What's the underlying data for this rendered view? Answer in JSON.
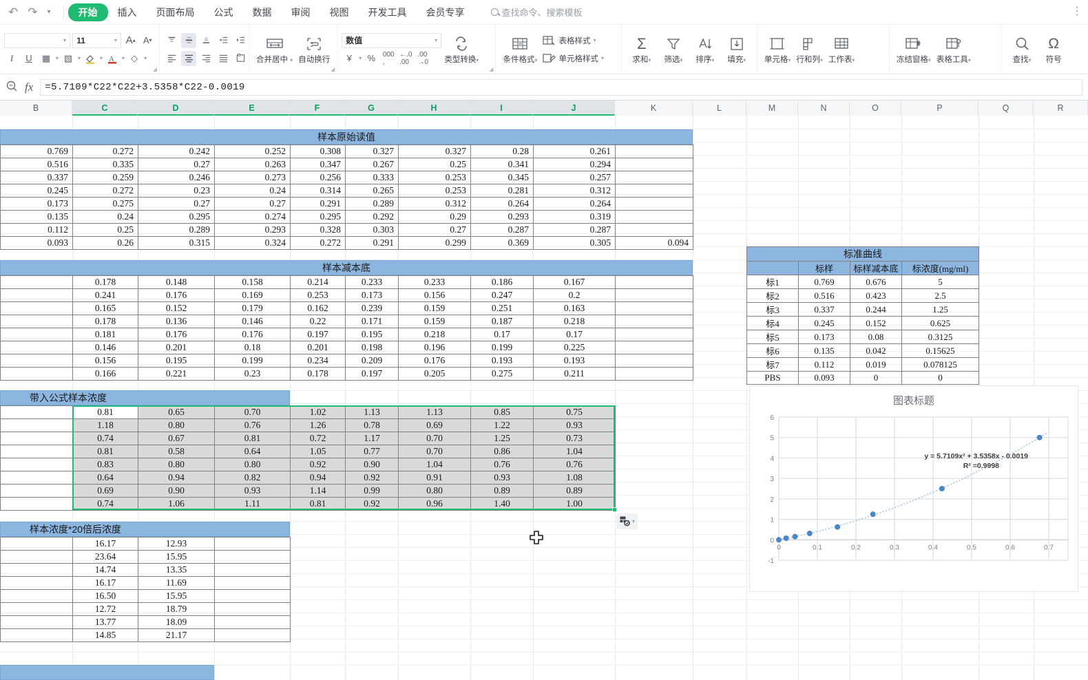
{
  "window": {
    "quick_access": [
      "undo-icon",
      "redo-icon",
      "customize-icon"
    ]
  },
  "tabs": [
    {
      "label": "开始",
      "active": true
    },
    {
      "label": "插入",
      "active": false
    },
    {
      "label": "页面布局",
      "active": false
    },
    {
      "label": "公式",
      "active": false
    },
    {
      "label": "数据",
      "active": false
    },
    {
      "label": "审阅",
      "active": false
    },
    {
      "label": "视图",
      "active": false
    },
    {
      "label": "开发工具",
      "active": false
    },
    {
      "label": "会员专享",
      "active": false
    }
  ],
  "search": {
    "placeholder": "查找命令、搜索模板"
  },
  "ribbon": {
    "font": {
      "name": "",
      "size": "11",
      "grow_label": "A",
      "shrink_label": "A"
    },
    "row2_buttons": [
      "italic-icon",
      "underline-icon",
      "borders-icon",
      "border-style-icon",
      "fill-color-icon",
      "font-color-icon",
      "clear-format-icon"
    ],
    "align_group": [
      "align-top-icon",
      "align-middle-icon",
      "align-bottom-icon",
      "decrease-indent-icon",
      "increase-indent-icon",
      "align-left-icon",
      "align-center-icon",
      "align-right-icon",
      "justify-icon",
      "wrap-icon",
      "merge-icon"
    ],
    "merge": {
      "label": "合并居中"
    },
    "wrap": {
      "label": "自动换行"
    },
    "number_format": {
      "value": "数值"
    },
    "number_buttons": [
      "currency-icon",
      "percent-icon",
      "comma-icon",
      "increase-decimal-icon",
      "decrease-decimal-icon"
    ],
    "type_convert": {
      "label": "类型转换"
    },
    "cond_format": {
      "label": "条件格式"
    },
    "table_style": {
      "label": "表格样式"
    },
    "cell_style": {
      "label": "单元格样式"
    },
    "sum": {
      "label": "求和"
    },
    "filter": {
      "label": "筛选"
    },
    "sort": {
      "label": "排序"
    },
    "fill": {
      "label": "填充"
    },
    "cells": {
      "label": "单元格"
    },
    "rows_cols": {
      "label": "行和列"
    },
    "sheet": {
      "label": "工作表"
    },
    "freeze": {
      "label": "冻结窗格"
    },
    "table_tools": {
      "label": "表格工具"
    },
    "find": {
      "label": "查找"
    },
    "symbol": {
      "label": "符号"
    }
  },
  "formula_bar": {
    "name_box": "",
    "fx_label": "fx",
    "formula": "=5.7109*C22*C22+3.5358*C22-0.0019"
  },
  "grid": {
    "columns": [
      "B",
      "C",
      "D",
      "E",
      "F",
      "G",
      "H",
      "I",
      "J",
      "K",
      "L",
      "M",
      "N",
      "O",
      "P",
      "Q",
      "R"
    ],
    "selected_columns": [
      "C",
      "D",
      "E",
      "F",
      "G",
      "H",
      "I",
      "J"
    ]
  },
  "sections": {
    "raw": {
      "title": "样本原始读值",
      "rows": [
        [
          "0.769",
          "0.272",
          "0.242",
          "0.252",
          "0.308",
          "0.327",
          "0.327",
          "0.28",
          "0.261",
          ""
        ],
        [
          "0.516",
          "0.335",
          "0.27",
          "0.263",
          "0.347",
          "0.267",
          "0.25",
          "0.341",
          "0.294",
          ""
        ],
        [
          "0.337",
          "0.259",
          "0.246",
          "0.273",
          "0.256",
          "0.333",
          "0.253",
          "0.345",
          "0.257",
          ""
        ],
        [
          "0.245",
          "0.272",
          "0.23",
          "0.24",
          "0.314",
          "0.265",
          "0.253",
          "0.281",
          "0.312",
          ""
        ],
        [
          "0.173",
          "0.275",
          "0.27",
          "0.27",
          "0.291",
          "0.289",
          "0.312",
          "0.264",
          "0.264",
          ""
        ],
        [
          "0.135",
          "0.24",
          "0.295",
          "0.274",
          "0.295",
          "0.292",
          "0.29",
          "0.293",
          "0.319",
          ""
        ],
        [
          "0.112",
          "0.25",
          "0.289",
          "0.293",
          "0.328",
          "0.303",
          "0.27",
          "0.287",
          "0.287",
          ""
        ],
        [
          "0.093",
          "0.26",
          "0.315",
          "0.324",
          "0.272",
          "0.291",
          "0.299",
          "0.369",
          "0.305",
          "0.094"
        ]
      ]
    },
    "minus_bg": {
      "title": "样本减本底",
      "rows": [
        [
          "",
          "0.178",
          "0.148",
          "0.158",
          "0.214",
          "0.233",
          "0.233",
          "0.186",
          "0.167",
          ""
        ],
        [
          "",
          "0.241",
          "0.176",
          "0.169",
          "0.253",
          "0.173",
          "0.156",
          "0.247",
          "0.2",
          ""
        ],
        [
          "",
          "0.165",
          "0.152",
          "0.179",
          "0.162",
          "0.239",
          "0.159",
          "0.251",
          "0.163",
          ""
        ],
        [
          "",
          "0.178",
          "0.136",
          "0.146",
          "0.22",
          "0.171",
          "0.159",
          "0.187",
          "0.218",
          ""
        ],
        [
          "",
          "0.181",
          "0.176",
          "0.176",
          "0.197",
          "0.195",
          "0.218",
          "0.17",
          "0.17",
          ""
        ],
        [
          "",
          "0.146",
          "0.201",
          "0.18",
          "0.201",
          "0.198",
          "0.196",
          "0.199",
          "0.225",
          ""
        ],
        [
          "",
          "0.156",
          "0.195",
          "0.199",
          "0.234",
          "0.209",
          "0.176",
          "0.193",
          "0.193",
          ""
        ],
        [
          "",
          "0.166",
          "0.221",
          "0.23",
          "0.178",
          "0.197",
          "0.205",
          "0.275",
          "0.211",
          ""
        ]
      ]
    },
    "conc": {
      "title": "带入公式样本浓度",
      "rows": [
        [
          "",
          "0.81",
          "0.65",
          "0.70",
          "1.02",
          "1.13",
          "1.13",
          "0.85",
          "0.75"
        ],
        [
          "",
          "1.18",
          "0.80",
          "0.76",
          "1.26",
          "0.78",
          "0.69",
          "1.22",
          "0.93"
        ],
        [
          "",
          "0.74",
          "0.67",
          "0.81",
          "0.72",
          "1.17",
          "0.70",
          "1.25",
          "0.73"
        ],
        [
          "",
          "0.81",
          "0.58",
          "0.64",
          "1.05",
          "0.77",
          "0.70",
          "0.86",
          "1.04"
        ],
        [
          "",
          "0.83",
          "0.80",
          "0.80",
          "0.92",
          "0.90",
          "1.04",
          "0.76",
          "0.76"
        ],
        [
          "",
          "0.64",
          "0.94",
          "0.82",
          "0.94",
          "0.92",
          "0.91",
          "0.93",
          "1.08"
        ],
        [
          "",
          "0.69",
          "0.90",
          "0.93",
          "1.14",
          "0.99",
          "0.80",
          "0.89",
          "0.89"
        ],
        [
          "",
          "0.74",
          "1.06",
          "1.11",
          "0.81",
          "0.92",
          "0.96",
          "1.40",
          "1.00"
        ]
      ]
    },
    "conc20": {
      "title": "样本浓度*20倍后浓度",
      "rows": [
        [
          "",
          "16.17",
          "12.93",
          ""
        ],
        [
          "",
          "23.64",
          "15.95",
          ""
        ],
        [
          "",
          "14.74",
          "13.35",
          ""
        ],
        [
          "",
          "16.17",
          "11.69",
          ""
        ],
        [
          "",
          "16.50",
          "15.95",
          ""
        ],
        [
          "",
          "12.72",
          "18.79",
          ""
        ],
        [
          "",
          "13.77",
          "18.09",
          ""
        ],
        [
          "",
          "14.85",
          "21.17",
          ""
        ]
      ]
    },
    "bottom_band": {
      "title": ""
    }
  },
  "standard_curve": {
    "title": "标准曲线",
    "headers": [
      "",
      "标样",
      "标样减本底",
      "标浓度(mg/ml)"
    ],
    "rows": [
      [
        "标1",
        "0.769",
        "0.676",
        "5"
      ],
      [
        "标2",
        "0.516",
        "0.423",
        "2.5"
      ],
      [
        "标3",
        "0.337",
        "0.244",
        "1.25"
      ],
      [
        "标4",
        "0.245",
        "0.152",
        "0.625"
      ],
      [
        "标5",
        "0.173",
        "0.08",
        "0.3125"
      ],
      [
        "标6",
        "0.135",
        "0.042",
        "0.15625"
      ],
      [
        "标7",
        "0.112",
        "0.019",
        "0.078125"
      ],
      [
        "PBS",
        "0.093",
        "0",
        "0"
      ]
    ]
  },
  "chart_data": {
    "type": "scatter",
    "title": "图表标题",
    "xlabel": "",
    "ylabel": "",
    "xlim": [
      0,
      0.75
    ],
    "ylim": [
      -1,
      6
    ],
    "xticks": [
      "0",
      "0.1",
      "0.2",
      "0.3",
      "0.4",
      "0.5",
      "0.6",
      "0.7"
    ],
    "yticks": [
      "-1",
      "0",
      "1",
      "2",
      "3",
      "4",
      "5",
      "6"
    ],
    "grid": true,
    "legend": "none",
    "x": [
      0,
      0.019,
      0.042,
      0.08,
      0.152,
      0.244,
      0.423,
      0.676
    ],
    "y": [
      0,
      0.078125,
      0.15625,
      0.3125,
      0.625,
      1.25,
      2.5,
      5
    ],
    "point_color": "#4a86c8",
    "trendline": {
      "type": "polynomial-2",
      "equation": "y = 5.7109x² + 3.5358x - 0.0019",
      "r2": "R² =0.9998",
      "color": "#9dc3e6"
    }
  },
  "overlays": {
    "paste_options": {
      "name": "粘贴选项"
    },
    "cursor": "cross-cursor"
  }
}
